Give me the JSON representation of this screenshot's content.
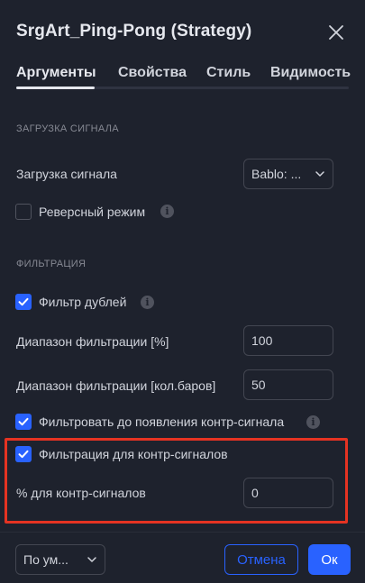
{
  "dialog": {
    "title": "SrgArt_Ping-Pong (Strategy)"
  },
  "tabs": [
    {
      "label": "Аргументы",
      "active": true
    },
    {
      "label": "Свойства",
      "active": false
    },
    {
      "label": "Стиль",
      "active": false
    },
    {
      "label": "Видимость",
      "active": false
    }
  ],
  "signal_section": {
    "title": "ЗАГРУЗКА СИГНАЛА",
    "load_signal_label": "Загрузка сигнала",
    "load_signal_value": "Bablo: ...",
    "reverse_mode": {
      "label": "Реверсный режим",
      "checked": false
    }
  },
  "filter_section": {
    "title": "ФИЛЬТРАЦИЯ",
    "duplicate_filter": {
      "label": "Фильтр дублей",
      "checked": true
    },
    "range_percent": {
      "label": "Диапазон фильтрации [%]",
      "value": "100"
    },
    "range_bars": {
      "label": "Диапазон фильтрации [кол.баров]",
      "value": "50"
    },
    "filter_until_counter": {
      "label": "Фильтровать до появления контр-сигнала",
      "checked": true
    },
    "counter_filter": {
      "label": "Фильтрация для контр-сигналов",
      "checked": true
    },
    "counter_percent": {
      "label": "% для контр-сигналов",
      "value": "0"
    }
  },
  "footer": {
    "defaults_label": "По ум...",
    "cancel_label": "Отмена",
    "ok_label": "Ок"
  },
  "icons": {
    "close": "close-icon",
    "chevron": "chevron-down-icon",
    "info": "info-icon",
    "check": "check-icon"
  },
  "colors": {
    "background": "#1e222d",
    "accent": "#2962ff",
    "highlight": "#e53322",
    "text": "#d1d4dc",
    "muted": "#868993"
  }
}
